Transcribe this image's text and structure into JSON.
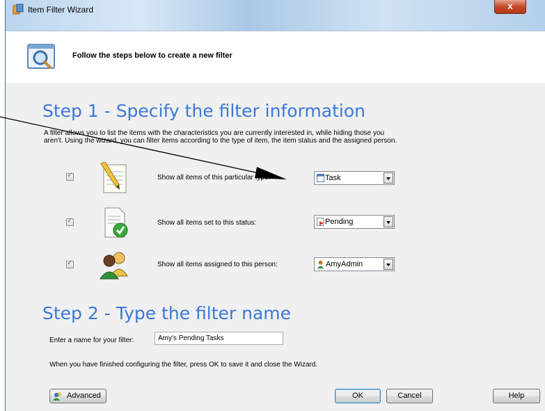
{
  "window": {
    "title": "Item Filter Wizard",
    "close_glyph": "x"
  },
  "header": {
    "text": "Follow the steps below to create a new filter",
    "icon": "magnifier-window-icon"
  },
  "step1": {
    "title": "Step 1 - Specify the filter information",
    "description": "A filter allows you to list the items with the characteristics you are currently interested in, while hiding those you aren't.  Using the wizard, you can filter items according to the type of item, the item status and the assigned person.",
    "rows": [
      {
        "label": "Show all items of this particular type:",
        "checked": true,
        "icon": "notepad-pencil-icon",
        "value": "Task",
        "value_icon": "task-icon"
      },
      {
        "label": "Show all items set to this status:",
        "checked": true,
        "icon": "document-check-icon",
        "value": "Pending",
        "value_icon": "pending-icon"
      },
      {
        "label": "Show all items assigned to this person:",
        "checked": true,
        "icon": "users-icon",
        "value": "AmyAdmin",
        "value_icon": "person-icon"
      }
    ]
  },
  "step2": {
    "title": "Step 2 - Type the filter name",
    "name_label": "Enter a name for your filter:",
    "name_value": "Amy's Pending Tasks"
  },
  "footer_text": "When you have finished configuring the filter, press OK to save it and close the Wizard.",
  "buttons": {
    "advanced": "Advanced",
    "ok": "OK",
    "cancel": "Cancel",
    "help": "Help"
  },
  "colors": {
    "step_title": "#3c78d8",
    "annotation_arrow": "#000000"
  }
}
